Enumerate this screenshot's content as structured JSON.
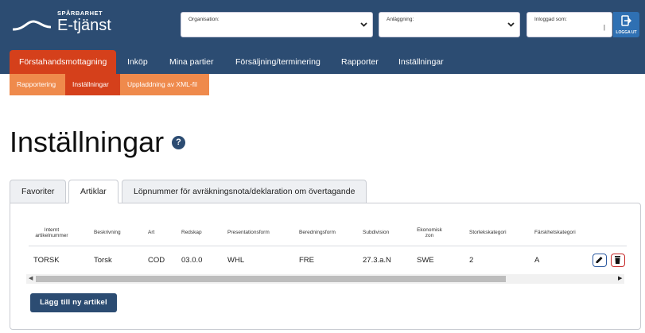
{
  "brand": {
    "small": "SPÅRBARHET",
    "name": "E-tjänst"
  },
  "header": {
    "organisation_label": "Organisation:",
    "anlaggning_label": "Anläggning:",
    "login_label": "Inloggad som:",
    "login_value": "|",
    "logout_label": "LOGGA UT"
  },
  "mainnav": [
    "Förstahandsmottagning",
    "Inköp",
    "Mina partier",
    "Försäljning/terminering",
    "Rapporter",
    "Inställningar"
  ],
  "subnav": [
    "Rapportering",
    "Inställningar",
    "Uppladdning av XML-fil"
  ],
  "page": {
    "title": "Inställningar",
    "help": "?"
  },
  "tabs": [
    "Favoriter",
    "Artiklar",
    "Löpnummer för avräkningsnota/deklaration om övertagande"
  ],
  "table": {
    "headers": {
      "internt": [
        "Internt",
        "artikelnummer"
      ],
      "beskrivning": "Beskrivning",
      "art": "Art",
      "redskap": "Redskap",
      "presentationsform": "Presentationsform",
      "beredningsform": "Beredningsform",
      "subdivision": "Subdivision",
      "ekonomisk": [
        "Ekonomisk",
        "zon"
      ],
      "storlek": "Storlekskategori",
      "farskhet": "Färskhetskategori"
    },
    "row": {
      "internt": "TORSK",
      "beskrivning": "Torsk",
      "art": "COD",
      "redskap": "03.0.0",
      "presentationsform": "WHL",
      "beredningsform": "FRE",
      "subdivision": "27.3.a.N",
      "ekonomisk": "SWE",
      "storlek": "2",
      "farskhet": "A"
    }
  },
  "add_button": "Lägg till ny artikel",
  "colors": {
    "header": "#2c4c72",
    "active": "#d5401b",
    "subnav": "#ef8a4c",
    "logout": "#2f70b3"
  }
}
